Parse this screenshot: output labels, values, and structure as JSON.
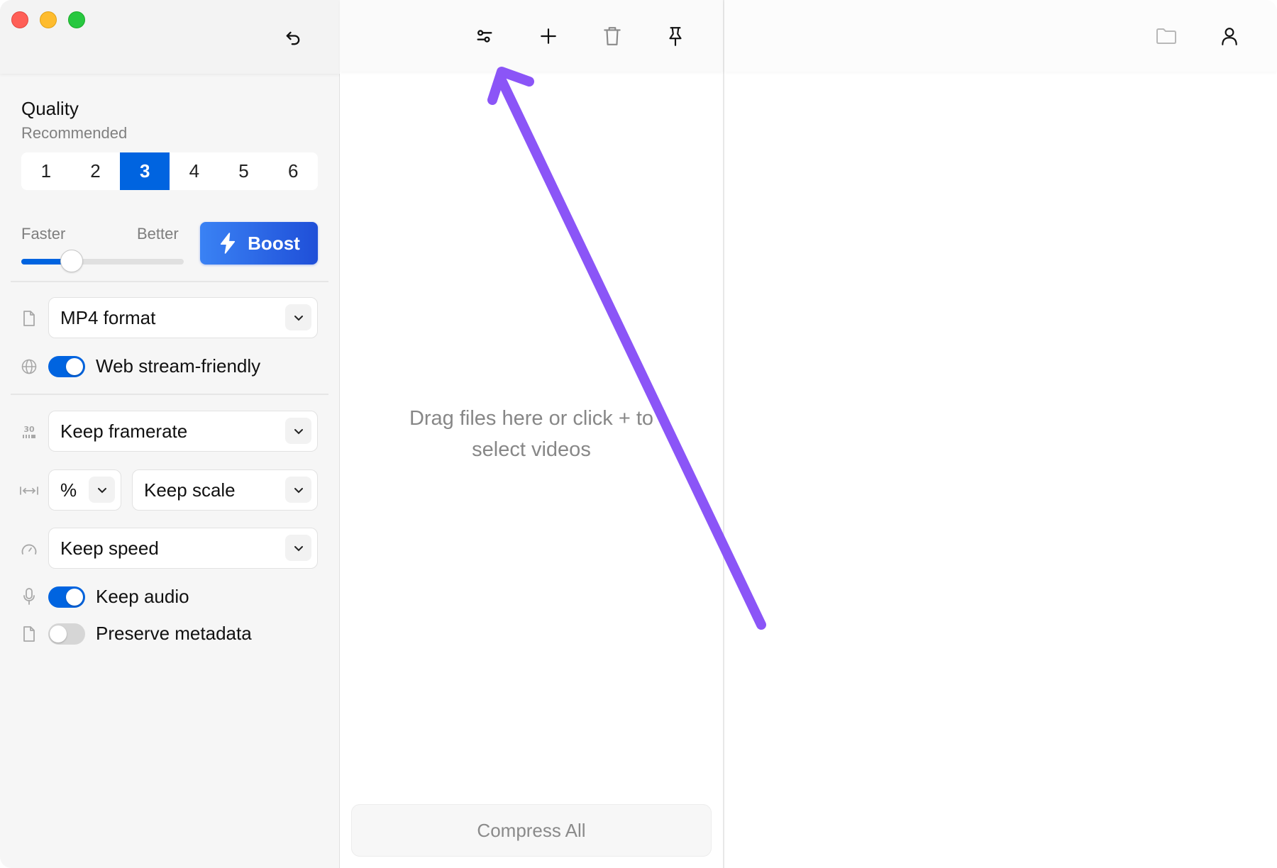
{
  "window": {
    "controls": [
      "close",
      "minimize",
      "zoom"
    ]
  },
  "sidebar": {
    "undo_icon": "undo-icon",
    "quality": {
      "title": "Quality",
      "subtitle": "Recommended",
      "levels": [
        "1",
        "2",
        "3",
        "4",
        "5",
        "6"
      ],
      "selected": "3"
    },
    "speed_slider": {
      "left_label": "Faster",
      "right_label": "Better",
      "value_fraction": 0.31
    },
    "boost": {
      "label": "Boost",
      "icon": "lightning-icon"
    },
    "format": {
      "icon": "file-icon",
      "value": "MP4 format"
    },
    "web_stream": {
      "icon": "globe-icon",
      "label": "Web stream-friendly",
      "on": true
    },
    "framerate": {
      "icon": "framerate-icon",
      "value": "Keep framerate"
    },
    "scale": {
      "icon": "resize-icon",
      "unit": "%",
      "value": "Keep scale"
    },
    "speed": {
      "icon": "speedometer-icon",
      "value": "Keep speed"
    },
    "audio": {
      "icon": "microphone-icon",
      "label": "Keep audio",
      "on": true
    },
    "metadata": {
      "icon": "file-icon",
      "label": "Preserve metadata",
      "on": false
    }
  },
  "middle": {
    "toolbar": [
      "settings-sliders-icon",
      "plus-icon",
      "trash-icon",
      "pin-icon"
    ],
    "drop_hint_line1": "Drag files here or click + to",
    "drop_hint_line2": "select videos",
    "compress_all": "Compress All"
  },
  "right": {
    "toolbar": [
      "folder-icon",
      "user-icon"
    ]
  },
  "annotation": {
    "type": "arrow",
    "color": "#8b55f7",
    "points_to": "settings-sliders-icon"
  },
  "colors": {
    "accent": "#0064e0",
    "boost_gradient_start": "#3a82f4",
    "boost_gradient_end": "#1f4fd8",
    "annotation": "#8b55f7"
  }
}
